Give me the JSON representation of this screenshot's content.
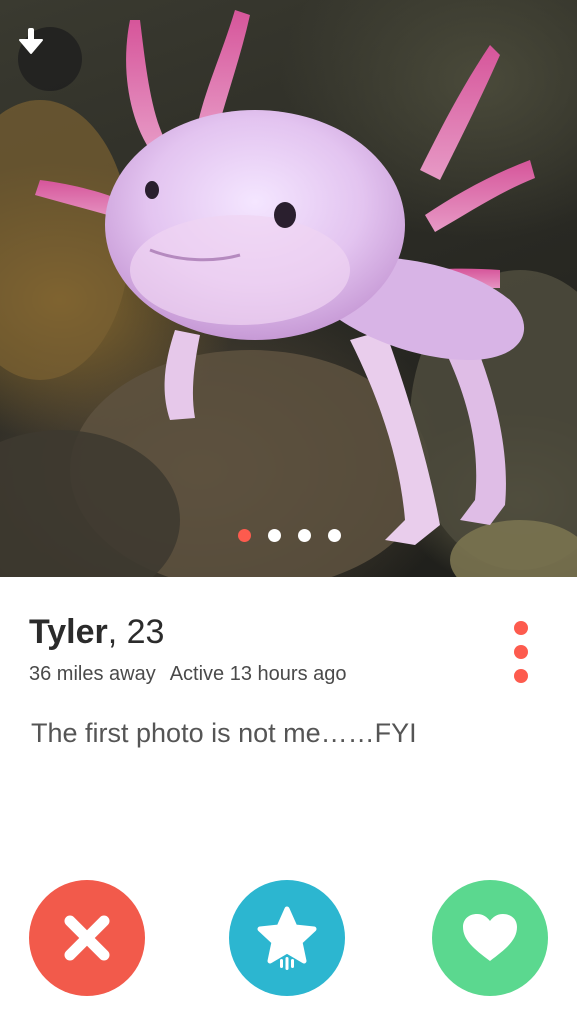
{
  "photo": {
    "download_icon": "arrow-down-icon",
    "page_dots": {
      "total": 4,
      "active_index": 0
    },
    "colors": {
      "dot_active": "#fd5b4e",
      "dot_inactive": "#ffffff"
    }
  },
  "profile": {
    "name": "Tyler",
    "age": ", 23",
    "distance": "36 miles away",
    "activity": "Active 13 hours ago",
    "bio": "The first photo is not me……FYI",
    "more_icon": "vertical-dots-icon"
  },
  "actions": {
    "nope": {
      "icon": "x-icon",
      "color": "#f25a4b"
    },
    "superlike": {
      "icon": "star-icon",
      "color": "#2cb6d0"
    },
    "like": {
      "icon": "heart-icon",
      "color": "#5bd88f"
    }
  }
}
